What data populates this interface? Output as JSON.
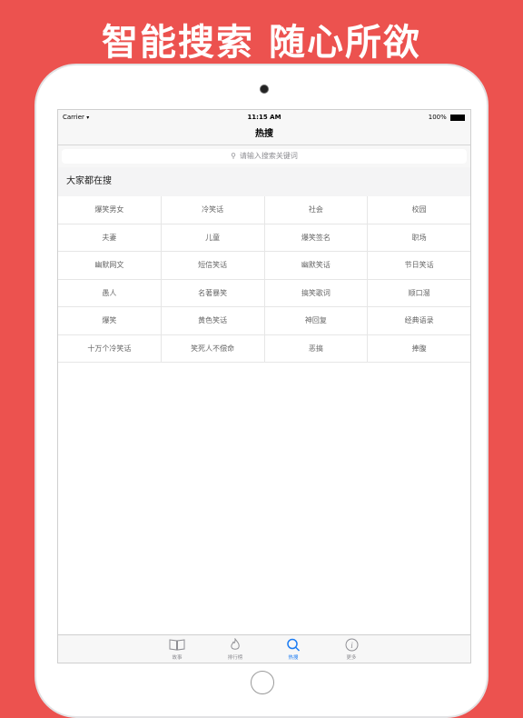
{
  "headline": "智能搜索 随心所欲",
  "status": {
    "carrier": "Carrier",
    "time": "11:15 AM",
    "battery": "100%"
  },
  "nav": {
    "title": "热搜"
  },
  "search": {
    "placeholder": "请输入搜索关键词"
  },
  "section": {
    "title": "大家都在搜"
  },
  "keywords": [
    [
      "爆笑男女",
      "冷笑话",
      "社会",
      "校园"
    ],
    [
      "夫妻",
      "儿童",
      "爆笑签名",
      "职场"
    ],
    [
      "幽默网文",
      "短信笑话",
      "幽默笑话",
      "节日笑话"
    ],
    [
      "愚人",
      "名著暴笑",
      "搞笑歌词",
      "顺口溜"
    ],
    [
      "爆笑",
      "黄色笑话",
      "神回复",
      "经典语录"
    ],
    [
      "十万个冷笑话",
      "笑死人不偿命",
      "恶搞",
      "捧腹"
    ]
  ],
  "tabs": [
    {
      "label": "故事",
      "icon": "book-icon",
      "active": false
    },
    {
      "label": "排行榜",
      "icon": "flame-icon",
      "active": false
    },
    {
      "label": "热搜",
      "icon": "search-icon",
      "active": true
    },
    {
      "label": "更多",
      "icon": "info-icon",
      "active": false
    }
  ],
  "colors": {
    "background": "#ec524f",
    "tab_active": "#1c7cf3",
    "tab_inactive": "#8e8e93"
  }
}
